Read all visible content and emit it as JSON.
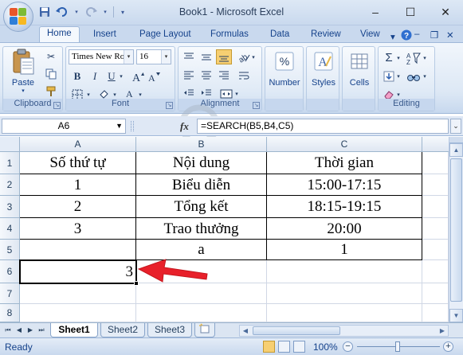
{
  "window": {
    "title": "Book1 - Microsoft Excel",
    "minimize": "–",
    "maximize": "☐",
    "close": "✕"
  },
  "tabs": [
    "Home",
    "Insert",
    "Page Layout",
    "Formulas",
    "Data",
    "Review",
    "View"
  ],
  "ribbon": {
    "clipboard": {
      "label": "Clipboard",
      "paste": "Paste"
    },
    "font": {
      "label": "Font",
      "name": "Times New Ro",
      "size": "16",
      "bold": "B",
      "italic": "I",
      "underline": "U"
    },
    "alignment": {
      "label": "Alignment"
    },
    "number": {
      "label": "Number"
    },
    "styles": {
      "label": "Styles"
    },
    "cells": {
      "label": "Cells"
    },
    "editing": {
      "label": "Editing"
    }
  },
  "formula_bar": {
    "name_box": "A6",
    "fx": "fx",
    "formula": "=SEARCH(B5,B4,C5)"
  },
  "grid": {
    "columns": [
      "A",
      "B",
      "C"
    ],
    "rows": [
      "1",
      "2",
      "3",
      "4",
      "5",
      "6",
      "7",
      "8"
    ],
    "cells": {
      "A1": "Số thứ tự",
      "B1": "Nội dung",
      "C1": "Thời gian",
      "A2": "1",
      "B2": "Biểu diễn",
      "C2": "15:00-17:15",
      "A3": "2",
      "B3": "Tổng kết",
      "C3": "18:15-19:15",
      "A4": "3",
      "B4": "Trao thưởng",
      "C4": "20:00",
      "A5": "",
      "B5": "a",
      "C5": "1",
      "A6": "3"
    },
    "selected_cell": "A6",
    "arrow_color": "#e8202a"
  },
  "sheets": [
    "Sheet1",
    "Sheet2",
    "Sheet3"
  ],
  "active_sheet": "Sheet1",
  "status": {
    "ready": "Ready",
    "zoom": "100%",
    "zoom_out": "−",
    "zoom_in": "+"
  },
  "colors": {
    "accent": "#15428b",
    "ribbon": "#dde8f5",
    "selected_header": "#f1c15f"
  }
}
